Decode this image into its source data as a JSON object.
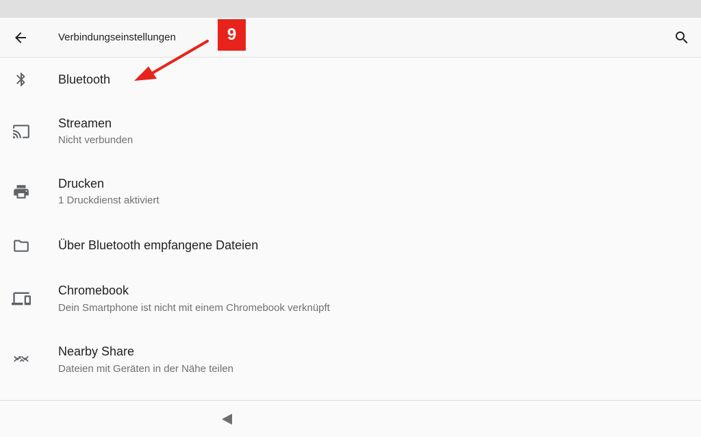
{
  "header": {
    "title": "Verbindungseinstellungen",
    "back_icon": "arrow-back-icon",
    "search_icon": "search-icon"
  },
  "items": [
    {
      "title": "Bluetooth",
      "subtitle": "",
      "icon": "bluetooth-icon"
    },
    {
      "title": "Streamen",
      "subtitle": "Nicht verbunden",
      "icon": "cast-icon"
    },
    {
      "title": "Drucken",
      "subtitle": "1 Druckdienst aktiviert",
      "icon": "printer-icon"
    },
    {
      "title": "Über Bluetooth empfangene Dateien",
      "subtitle": "",
      "icon": "folder-icon"
    },
    {
      "title": "Chromebook",
      "subtitle": "Dein Smartphone ist nicht mit einem Chromebook verknüpft",
      "icon": "devices-icon"
    },
    {
      "title": "Nearby Share",
      "subtitle": "Dateien mit Geräten in der Nähe teilen",
      "icon": "nearby-share-icon"
    }
  ],
  "annotation": {
    "step_number": "9",
    "color": "#e8231b"
  },
  "colors": {
    "icon": "#5f6368",
    "text_primary": "#202124",
    "text_secondary": "#6f6f6f"
  }
}
